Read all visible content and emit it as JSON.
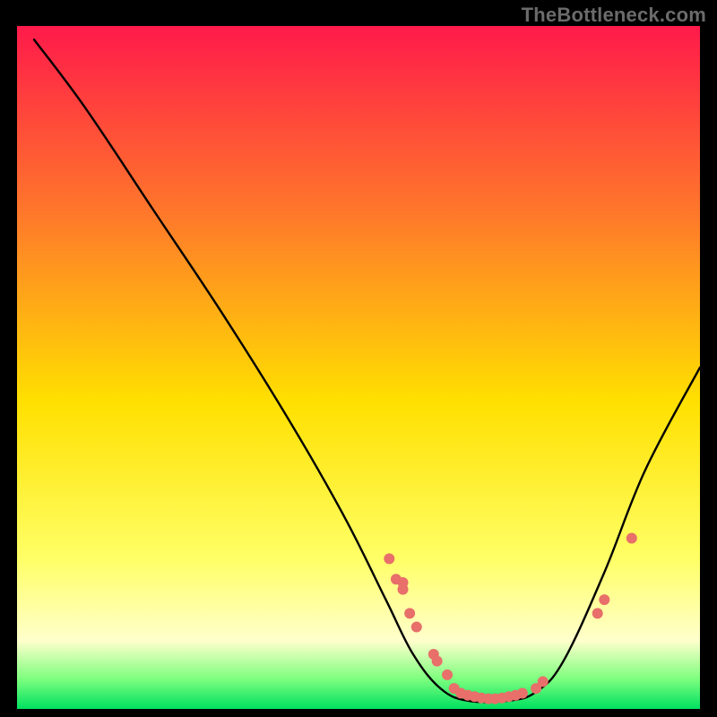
{
  "watermark": "TheBottleneck.com",
  "chart_data": {
    "type": "line",
    "title": "",
    "xlabel": "",
    "ylabel": "",
    "xlim": [
      0,
      100
    ],
    "ylim": [
      0,
      100
    ],
    "gradient_colors": {
      "top": "#ff1a4a",
      "upper_mid": "#ff7a2a",
      "mid": "#ffe000",
      "lower_mid": "#ffff66",
      "pale": "#ffffcc",
      "light_green": "#80ff80",
      "green": "#00e060"
    },
    "curve": [
      {
        "x": 2.5,
        "y": 98
      },
      {
        "x": 10,
        "y": 88
      },
      {
        "x": 20,
        "y": 73
      },
      {
        "x": 30,
        "y": 58
      },
      {
        "x": 40,
        "y": 42
      },
      {
        "x": 48,
        "y": 28
      },
      {
        "x": 54,
        "y": 16
      },
      {
        "x": 58,
        "y": 8
      },
      {
        "x": 62,
        "y": 3
      },
      {
        "x": 66,
        "y": 1.2
      },
      {
        "x": 72,
        "y": 1.2
      },
      {
        "x": 76,
        "y": 2.5
      },
      {
        "x": 80,
        "y": 7
      },
      {
        "x": 86,
        "y": 20
      },
      {
        "x": 92,
        "y": 35
      },
      {
        "x": 100,
        "y": 50
      }
    ],
    "markers": [
      {
        "x": 54.5,
        "y": 22
      },
      {
        "x": 55.5,
        "y": 19
      },
      {
        "x": 56.5,
        "y": 17.5
      },
      {
        "x": 56.5,
        "y": 18.5
      },
      {
        "x": 57.5,
        "y": 14
      },
      {
        "x": 58.5,
        "y": 12
      },
      {
        "x": 61,
        "y": 8
      },
      {
        "x": 61.5,
        "y": 7
      },
      {
        "x": 63,
        "y": 5
      },
      {
        "x": 64,
        "y": 3
      },
      {
        "x": 65,
        "y": 2.3
      },
      {
        "x": 66,
        "y": 2
      },
      {
        "x": 67,
        "y": 1.8
      },
      {
        "x": 68,
        "y": 1.6
      },
      {
        "x": 69,
        "y": 1.5
      },
      {
        "x": 70,
        "y": 1.5
      },
      {
        "x": 71,
        "y": 1.6
      },
      {
        "x": 72,
        "y": 1.8
      },
      {
        "x": 73,
        "y": 2
      },
      {
        "x": 74,
        "y": 2.3
      },
      {
        "x": 76,
        "y": 3
      },
      {
        "x": 77,
        "y": 4
      },
      {
        "x": 85,
        "y": 14
      },
      {
        "x": 86,
        "y": 16
      },
      {
        "x": 90,
        "y": 25
      }
    ],
    "marker_color": "#e86f6a",
    "marker_radius": 6
  }
}
